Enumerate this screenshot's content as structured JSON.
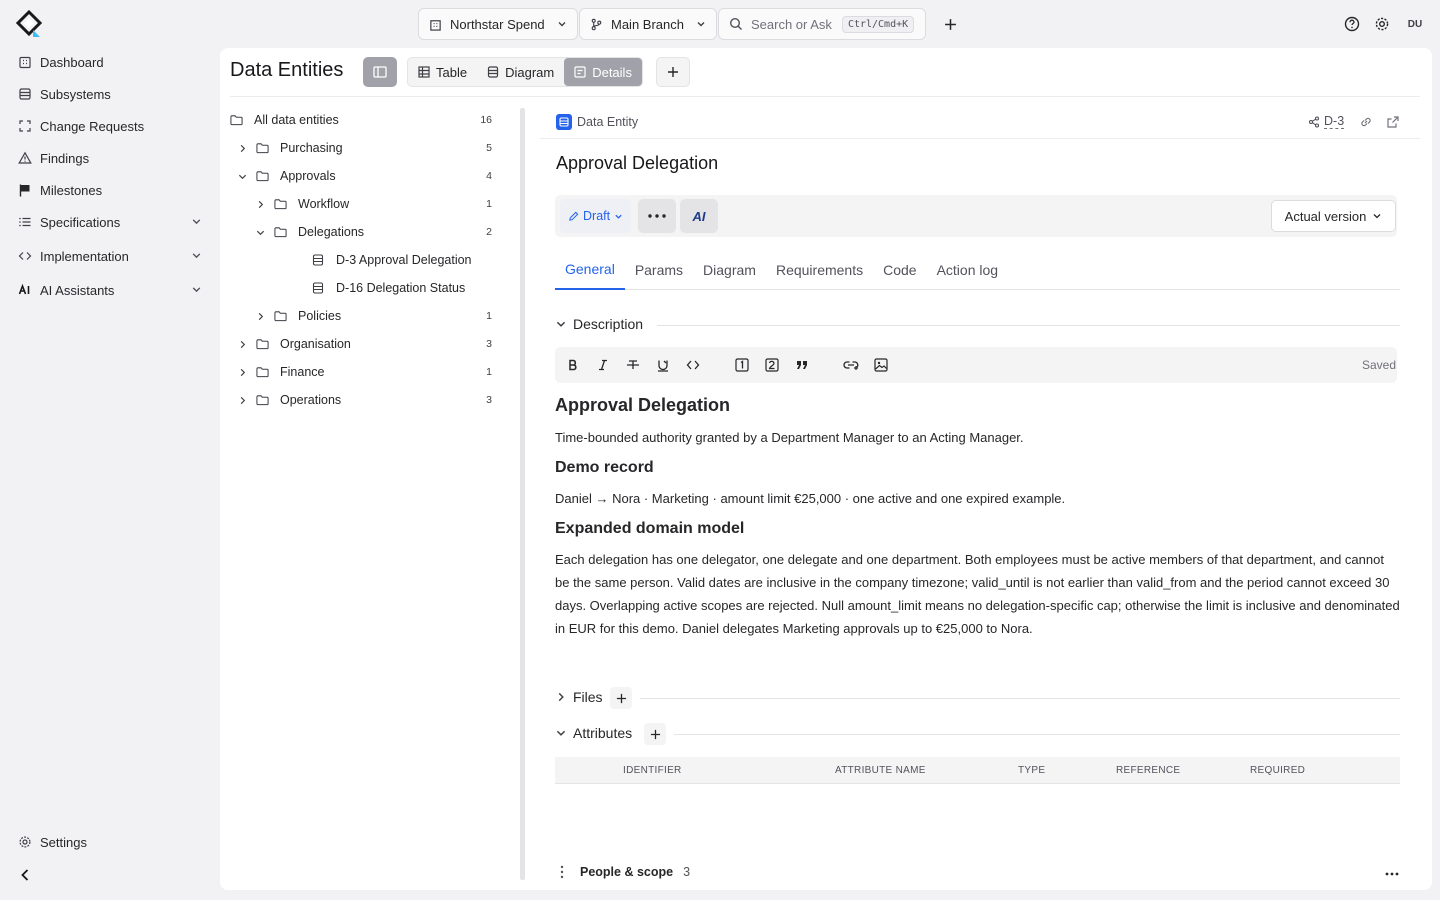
{
  "topbar": {
    "project": "Northstar Spend",
    "branch": "Main Branch",
    "search_placeholder": "Search or Ask",
    "search_shortcut": "Ctrl/Cmd+K",
    "avatar_initials": "DU"
  },
  "sidebar": {
    "items": [
      {
        "label": "Dashboard",
        "icon": "building-icon"
      },
      {
        "label": "Subsystems",
        "icon": "database-icon"
      },
      {
        "label": "Change Requests",
        "icon": "frame-icon"
      },
      {
        "label": "Findings",
        "icon": "warning-icon"
      },
      {
        "label": "Milestones",
        "icon": "flag-icon"
      },
      {
        "label": "Specifications",
        "icon": "list-icon"
      },
      {
        "label": "Implementation",
        "icon": "code-icon"
      },
      {
        "label": "AI Assistants",
        "icon": "ai-icon"
      }
    ],
    "settings_label": "Settings"
  },
  "page": {
    "title": "Data Entities",
    "views": [
      "Table",
      "Diagram",
      "Details"
    ],
    "active_view": "Details"
  },
  "tree": {
    "rows": [
      {
        "label": "All data entities",
        "count": "16",
        "kind": "folder",
        "level": 0,
        "toggle": "none"
      },
      {
        "label": "Purchasing",
        "count": "5",
        "kind": "folder",
        "level": 1,
        "toggle": "closed"
      },
      {
        "label": "Approvals",
        "count": "4",
        "kind": "folder",
        "level": 1,
        "toggle": "open"
      },
      {
        "label": "Workflow",
        "count": "1",
        "kind": "folder",
        "level": 2,
        "toggle": "closed"
      },
      {
        "label": "Delegations",
        "count": "2",
        "kind": "folder",
        "level": 2,
        "toggle": "open"
      },
      {
        "label": "D-3 Approval Delegation",
        "count": "",
        "kind": "entity",
        "level": 3,
        "toggle": "none"
      },
      {
        "label": "D-16 Delegation Status",
        "count": "",
        "kind": "entity",
        "level": 3,
        "toggle": "none"
      },
      {
        "label": "Policies",
        "count": "1",
        "kind": "folder",
        "level": 2,
        "toggle": "closed"
      },
      {
        "label": "Organisation",
        "count": "3",
        "kind": "folder",
        "level": 1,
        "toggle": "closed"
      },
      {
        "label": "Finance",
        "count": "1",
        "kind": "folder",
        "level": 1,
        "toggle": "closed"
      },
      {
        "label": "Operations",
        "count": "3",
        "kind": "folder",
        "level": 1,
        "toggle": "closed"
      }
    ]
  },
  "entity": {
    "type_label": "Data Entity",
    "id": "D-3",
    "title": "Approval Delegation",
    "status": "Draft",
    "ai_label": "AI",
    "version": "Actual version",
    "tabs": [
      "General",
      "Params",
      "Diagram",
      "Requirements",
      "Code",
      "Action log"
    ],
    "active_tab": "General"
  },
  "description": {
    "section_label": "Description",
    "saved_label": "Saved",
    "h1": "Approval Delegation",
    "p1": "Time-bounded authority granted by a Department Manager to an Acting Manager.",
    "h2a": "Demo record",
    "p2": "Daniel → Nora · Marketing · amount limit €25,000 · one active and one expired example.",
    "h2b": "Expanded domain model",
    "p3": "Each delegation has one delegator, one delegate and one department. Both employees must be active members of that department, and cannot be the same person. Valid dates are inclusive in the company timezone; valid_until is not earlier than valid_from and the period cannot exceed 30 days. Overlapping active scopes are rejected. Null amount_limit means no delegation-specific cap; otherwise the limit is inclusive and denominated in EUR for this demo. Daniel delegates Marketing approvals up to €25,000 to Nora."
  },
  "files": {
    "section_label": "Files"
  },
  "attributes": {
    "section_label": "Attributes",
    "columns": [
      "IDENTIFIER",
      "ATTRIBUTE NAME",
      "TYPE",
      "REFERENCE",
      "REQUIRED"
    ]
  },
  "people": {
    "label": "People & scope",
    "count": "3"
  },
  "colors": {
    "accent": "#2563eb",
    "panel": "#ffffff",
    "background": "#f2f2f4"
  }
}
